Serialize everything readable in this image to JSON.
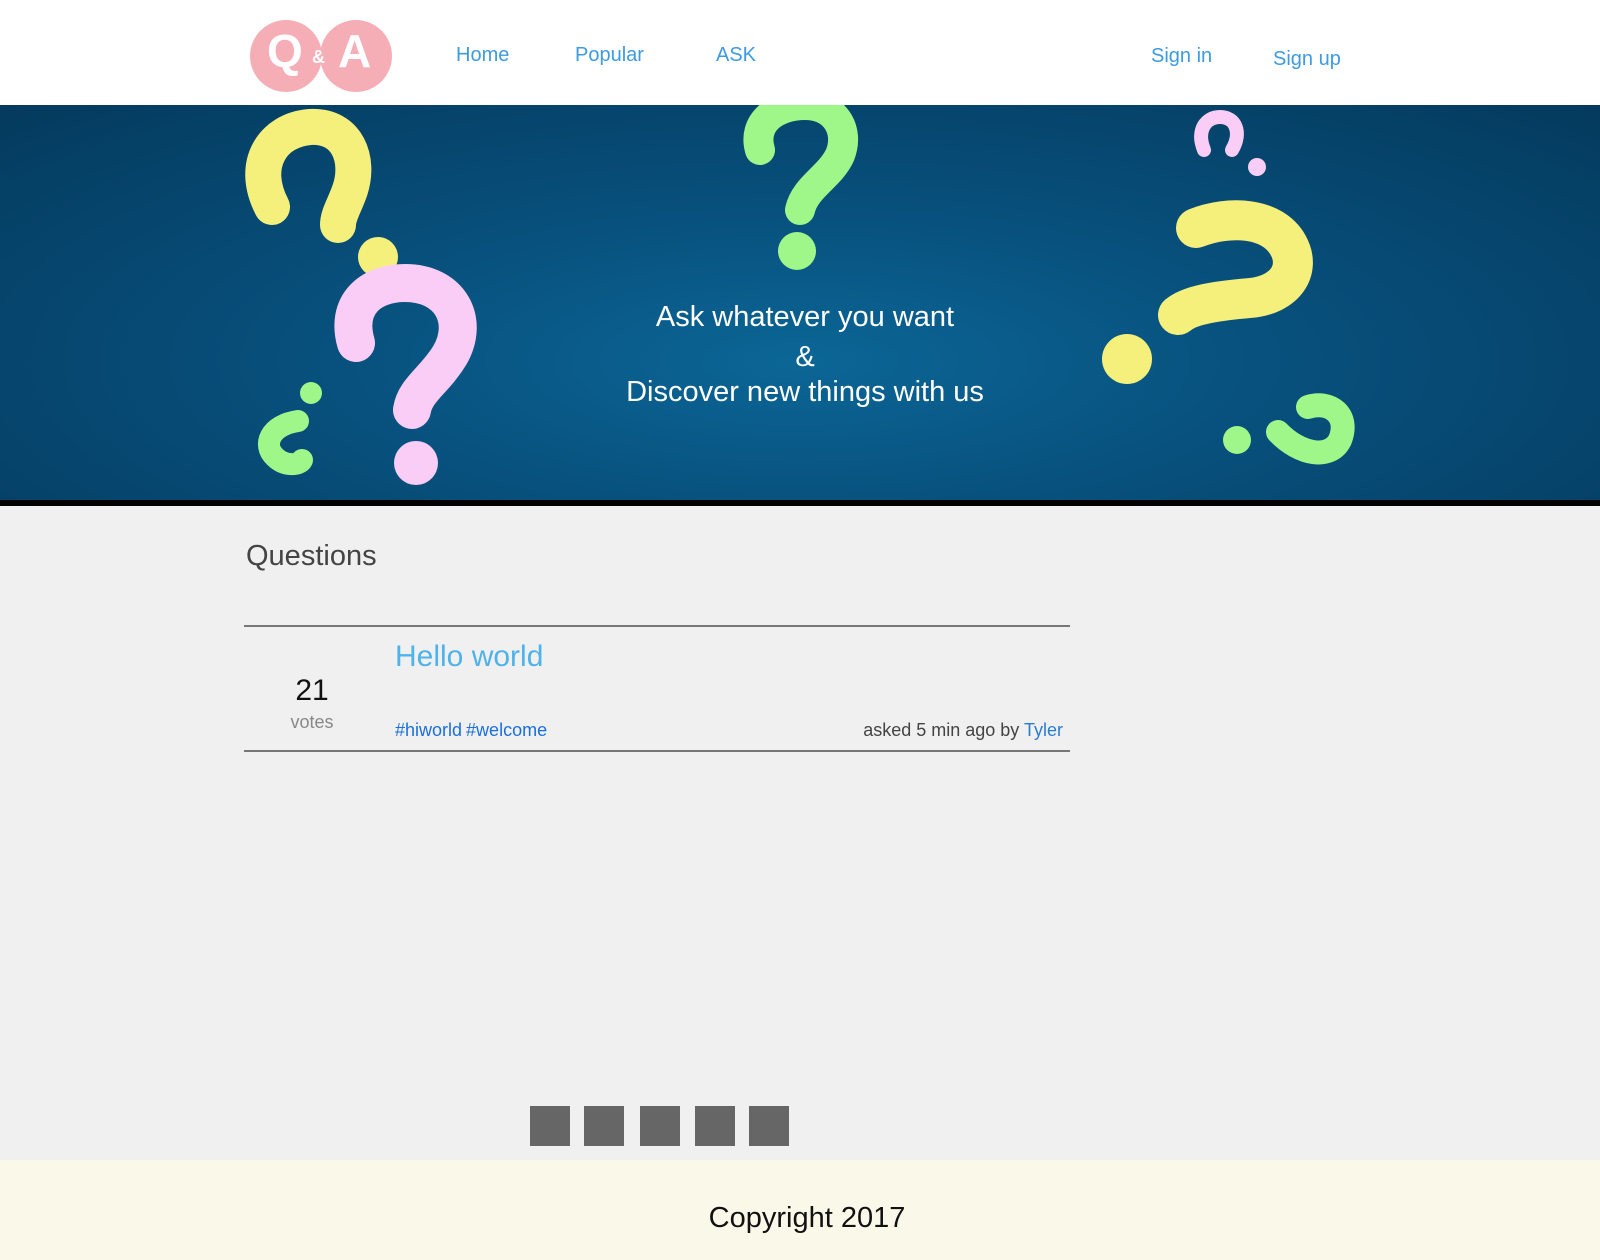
{
  "header": {
    "logo": {
      "left_letter": "Q",
      "amp": "&",
      "right_letter": "A"
    },
    "nav": {
      "home": "Home",
      "popular": "Popular",
      "ask": "ASK"
    },
    "auth": {
      "sign_in": "Sign in",
      "sign_up": "Sign up"
    }
  },
  "hero": {
    "line1": "Ask whatever you want",
    "amp": "&",
    "line2": "Discover new things with us",
    "colors": {
      "yellow": "#f5f07c",
      "pink": "#f9cdf6",
      "green": "#9ff78a",
      "bg": "#08517e"
    }
  },
  "main": {
    "section_title": "Questions",
    "questions": [
      {
        "votes": "21",
        "votes_label": "votes",
        "title": "Hello world",
        "tags": [
          "#hiworld",
          "#welcome"
        ],
        "meta_prefix": "asked 5 min ago by",
        "author": "Tyler"
      }
    ]
  },
  "footer": {
    "copyright": "Copyright 2017"
  },
  "colors": {
    "link": "#3d9be0",
    "title_link": "#4fb3ea",
    "logo": "#f6aeb6",
    "pager": "#666666",
    "footer_bg": "#faf9e9"
  }
}
